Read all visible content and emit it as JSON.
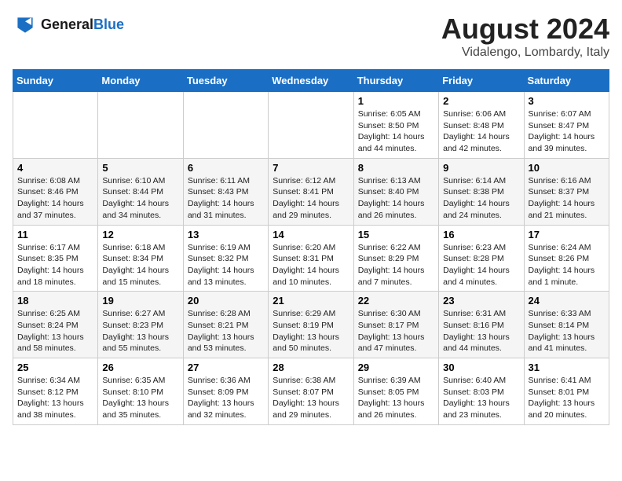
{
  "header": {
    "logo_line1": "General",
    "logo_line2": "Blue",
    "month": "August 2024",
    "location": "Vidalengo, Lombardy, Italy"
  },
  "days_of_week": [
    "Sunday",
    "Monday",
    "Tuesday",
    "Wednesday",
    "Thursday",
    "Friday",
    "Saturday"
  ],
  "weeks": [
    [
      {
        "day": "",
        "info": ""
      },
      {
        "day": "",
        "info": ""
      },
      {
        "day": "",
        "info": ""
      },
      {
        "day": "",
        "info": ""
      },
      {
        "day": "1",
        "info": "Sunrise: 6:05 AM\nSunset: 8:50 PM\nDaylight: 14 hours and 44 minutes."
      },
      {
        "day": "2",
        "info": "Sunrise: 6:06 AM\nSunset: 8:48 PM\nDaylight: 14 hours and 42 minutes."
      },
      {
        "day": "3",
        "info": "Sunrise: 6:07 AM\nSunset: 8:47 PM\nDaylight: 14 hours and 39 minutes."
      }
    ],
    [
      {
        "day": "4",
        "info": "Sunrise: 6:08 AM\nSunset: 8:46 PM\nDaylight: 14 hours and 37 minutes."
      },
      {
        "day": "5",
        "info": "Sunrise: 6:10 AM\nSunset: 8:44 PM\nDaylight: 14 hours and 34 minutes."
      },
      {
        "day": "6",
        "info": "Sunrise: 6:11 AM\nSunset: 8:43 PM\nDaylight: 14 hours and 31 minutes."
      },
      {
        "day": "7",
        "info": "Sunrise: 6:12 AM\nSunset: 8:41 PM\nDaylight: 14 hours and 29 minutes."
      },
      {
        "day": "8",
        "info": "Sunrise: 6:13 AM\nSunset: 8:40 PM\nDaylight: 14 hours and 26 minutes."
      },
      {
        "day": "9",
        "info": "Sunrise: 6:14 AM\nSunset: 8:38 PM\nDaylight: 14 hours and 24 minutes."
      },
      {
        "day": "10",
        "info": "Sunrise: 6:16 AM\nSunset: 8:37 PM\nDaylight: 14 hours and 21 minutes."
      }
    ],
    [
      {
        "day": "11",
        "info": "Sunrise: 6:17 AM\nSunset: 8:35 PM\nDaylight: 14 hours and 18 minutes."
      },
      {
        "day": "12",
        "info": "Sunrise: 6:18 AM\nSunset: 8:34 PM\nDaylight: 14 hours and 15 minutes."
      },
      {
        "day": "13",
        "info": "Sunrise: 6:19 AM\nSunset: 8:32 PM\nDaylight: 14 hours and 13 minutes."
      },
      {
        "day": "14",
        "info": "Sunrise: 6:20 AM\nSunset: 8:31 PM\nDaylight: 14 hours and 10 minutes."
      },
      {
        "day": "15",
        "info": "Sunrise: 6:22 AM\nSunset: 8:29 PM\nDaylight: 14 hours and 7 minutes."
      },
      {
        "day": "16",
        "info": "Sunrise: 6:23 AM\nSunset: 8:28 PM\nDaylight: 14 hours and 4 minutes."
      },
      {
        "day": "17",
        "info": "Sunrise: 6:24 AM\nSunset: 8:26 PM\nDaylight: 14 hours and 1 minute."
      }
    ],
    [
      {
        "day": "18",
        "info": "Sunrise: 6:25 AM\nSunset: 8:24 PM\nDaylight: 13 hours and 58 minutes."
      },
      {
        "day": "19",
        "info": "Sunrise: 6:27 AM\nSunset: 8:23 PM\nDaylight: 13 hours and 55 minutes."
      },
      {
        "day": "20",
        "info": "Sunrise: 6:28 AM\nSunset: 8:21 PM\nDaylight: 13 hours and 53 minutes."
      },
      {
        "day": "21",
        "info": "Sunrise: 6:29 AM\nSunset: 8:19 PM\nDaylight: 13 hours and 50 minutes."
      },
      {
        "day": "22",
        "info": "Sunrise: 6:30 AM\nSunset: 8:17 PM\nDaylight: 13 hours and 47 minutes."
      },
      {
        "day": "23",
        "info": "Sunrise: 6:31 AM\nSunset: 8:16 PM\nDaylight: 13 hours and 44 minutes."
      },
      {
        "day": "24",
        "info": "Sunrise: 6:33 AM\nSunset: 8:14 PM\nDaylight: 13 hours and 41 minutes."
      }
    ],
    [
      {
        "day": "25",
        "info": "Sunrise: 6:34 AM\nSunset: 8:12 PM\nDaylight: 13 hours and 38 minutes."
      },
      {
        "day": "26",
        "info": "Sunrise: 6:35 AM\nSunset: 8:10 PM\nDaylight: 13 hours and 35 minutes."
      },
      {
        "day": "27",
        "info": "Sunrise: 6:36 AM\nSunset: 8:09 PM\nDaylight: 13 hours and 32 minutes."
      },
      {
        "day": "28",
        "info": "Sunrise: 6:38 AM\nSunset: 8:07 PM\nDaylight: 13 hours and 29 minutes."
      },
      {
        "day": "29",
        "info": "Sunrise: 6:39 AM\nSunset: 8:05 PM\nDaylight: 13 hours and 26 minutes."
      },
      {
        "day": "30",
        "info": "Sunrise: 6:40 AM\nSunset: 8:03 PM\nDaylight: 13 hours and 23 minutes."
      },
      {
        "day": "31",
        "info": "Sunrise: 6:41 AM\nSunset: 8:01 PM\nDaylight: 13 hours and 20 minutes."
      }
    ]
  ]
}
